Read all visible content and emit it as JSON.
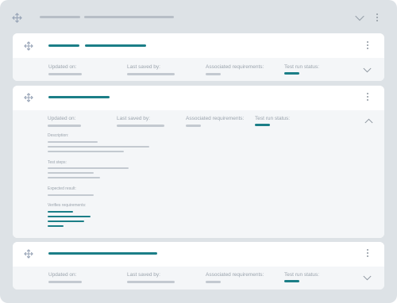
{
  "colors": {
    "accent": "#1b7e87",
    "placeholder": "#c3c9d0",
    "background": "#dde2e6"
  },
  "icons": [
    "move-icon",
    "chevron-down-icon",
    "chevron-up-icon",
    "kebab-menu-icon"
  ],
  "group": {
    "state": "collapsed-header"
  },
  "cards": [
    {
      "expanded": false,
      "fields": {
        "updated_on": "Updated on:",
        "last_saved_by": "Last saved by:",
        "associated_requirements": "Associated requirements:",
        "test_run_status": "Test run status:"
      }
    },
    {
      "expanded": true,
      "fields": {
        "updated_on": "Updated on:",
        "last_saved_by": "Last saved by:",
        "associated_requirements": "Associated requirements:",
        "test_run_status": "Test run status:"
      },
      "details": {
        "description": "Description:",
        "test_steps": "Test steps:",
        "expected_result": "Expected result:",
        "verifies_requirements": "Verifies requirements:"
      }
    },
    {
      "expanded": false,
      "fields": {
        "updated_on": "Updated on:",
        "last_saved_by": "Last saved by:",
        "associated_requirements": "Associated requirements:",
        "test_run_status": "Test run status:"
      }
    }
  ]
}
